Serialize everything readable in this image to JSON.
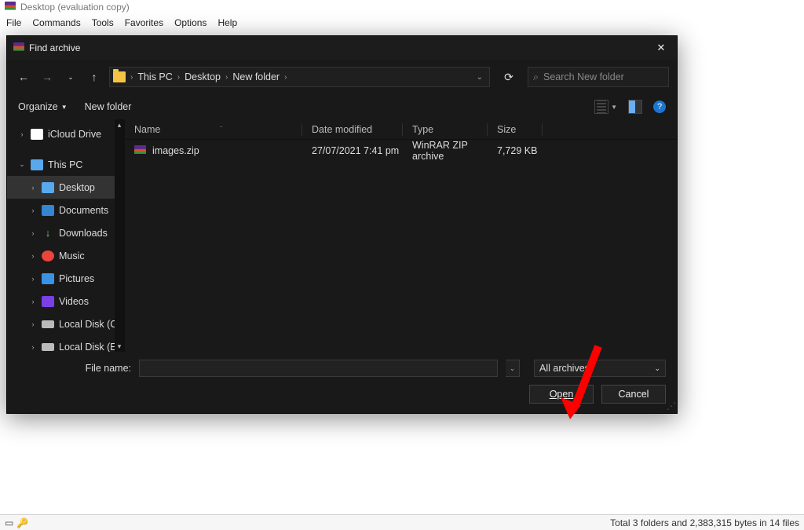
{
  "parent": {
    "title": "Desktop (evaluation copy)",
    "menu": [
      "File",
      "Commands",
      "Tools",
      "Favorites",
      "Options",
      "Help"
    ],
    "status_right": "Total 3 folders and 2,383,315 bytes in 14 files"
  },
  "dialog": {
    "title": "Find archive",
    "breadcrumb": [
      "This PC",
      "Desktop",
      "New folder"
    ],
    "search_placeholder": "Search New folder",
    "toolbar": {
      "organize": "Organize",
      "new_folder": "New folder"
    },
    "tree": [
      {
        "label": "iCloud Drive",
        "icon": "cloud",
        "caret": ">"
      },
      {
        "label": "This PC",
        "icon": "pc",
        "caret": "v"
      },
      {
        "label": "Desktop",
        "icon": "desktop",
        "caret": ">",
        "sub": true,
        "selected": true
      },
      {
        "label": "Documents",
        "icon": "doc",
        "caret": ">",
        "sub": true
      },
      {
        "label": "Downloads",
        "icon": "dl",
        "caret": ">",
        "sub": true
      },
      {
        "label": "Music",
        "icon": "music",
        "caret": ">",
        "sub": true
      },
      {
        "label": "Pictures",
        "icon": "pic",
        "caret": ">",
        "sub": true
      },
      {
        "label": "Videos",
        "icon": "vid",
        "caret": ">",
        "sub": true
      },
      {
        "label": "Local Disk (C:)",
        "icon": "disk",
        "caret": ">",
        "sub": true
      },
      {
        "label": "Local Disk (E:)",
        "icon": "disk",
        "caret": ">",
        "sub": true
      }
    ],
    "columns": {
      "name": "Name",
      "date": "Date modified",
      "type": "Type",
      "size": "Size"
    },
    "files": [
      {
        "name": "images.zip",
        "date": "27/07/2021 7:41 pm",
        "type": "WinRAR ZIP archive",
        "size": "7,729 KB"
      }
    ],
    "file_name_label": "File name:",
    "filter": "All archives",
    "open_label": "Open",
    "cancel_label": "Cancel"
  }
}
